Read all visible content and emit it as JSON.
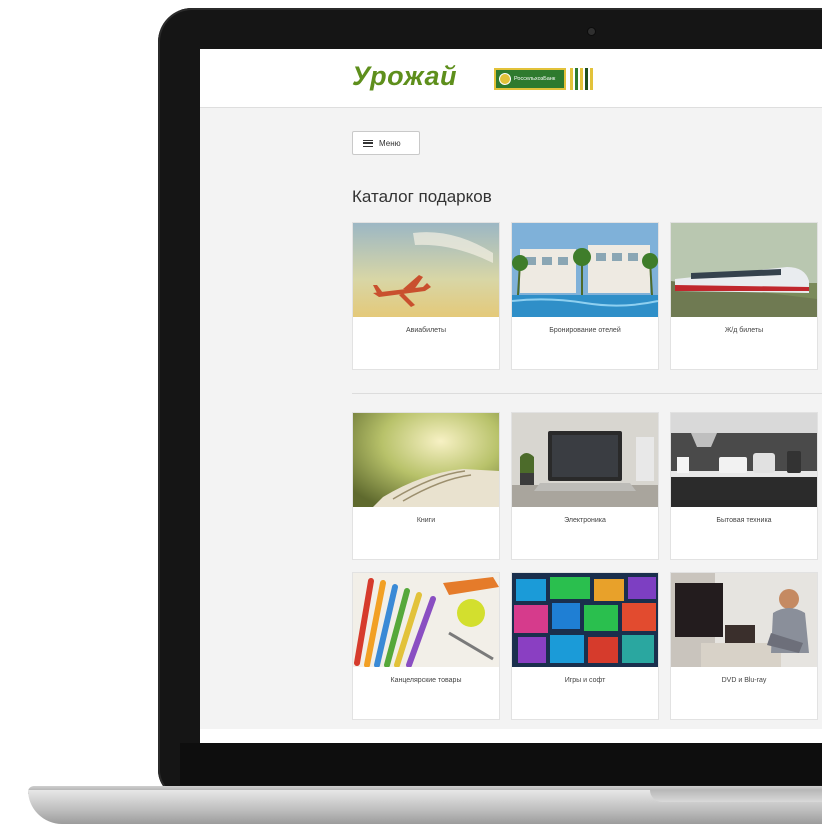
{
  "header": {
    "logo_text": "Урожай",
    "bank_name": "РоссельхозБанк",
    "bank_stripes": [
      "#e2c23a",
      "#2e7a2e",
      "#e2c23a",
      "#1d4f1d",
      "#e2c23a"
    ]
  },
  "menu": {
    "label": "Меню",
    "icon": "hamburger-icon"
  },
  "catalog": {
    "title": "Каталог подарков",
    "items": [
      {
        "label": "Авиабилеты",
        "image": "airplane-sky"
      },
      {
        "label": "Бронирование отелей",
        "image": "hotel-pool"
      },
      {
        "label": "Ж/д билеты",
        "image": "train"
      },
      {
        "label": "Книги",
        "image": "book"
      },
      {
        "label": "Электроника",
        "image": "laptop"
      },
      {
        "label": "Бытовая техника",
        "image": "kitchen"
      },
      {
        "label": "Канцелярские товары",
        "image": "pencils"
      },
      {
        "label": "Игры и софт",
        "image": "tiles"
      },
      {
        "label": "DVD и Blu-ray",
        "image": "tv-woman"
      }
    ]
  },
  "colors": {
    "brand_green": "#5e8f1c",
    "bank_green": "#2e7a2e",
    "bank_gold": "#e2c23a"
  }
}
